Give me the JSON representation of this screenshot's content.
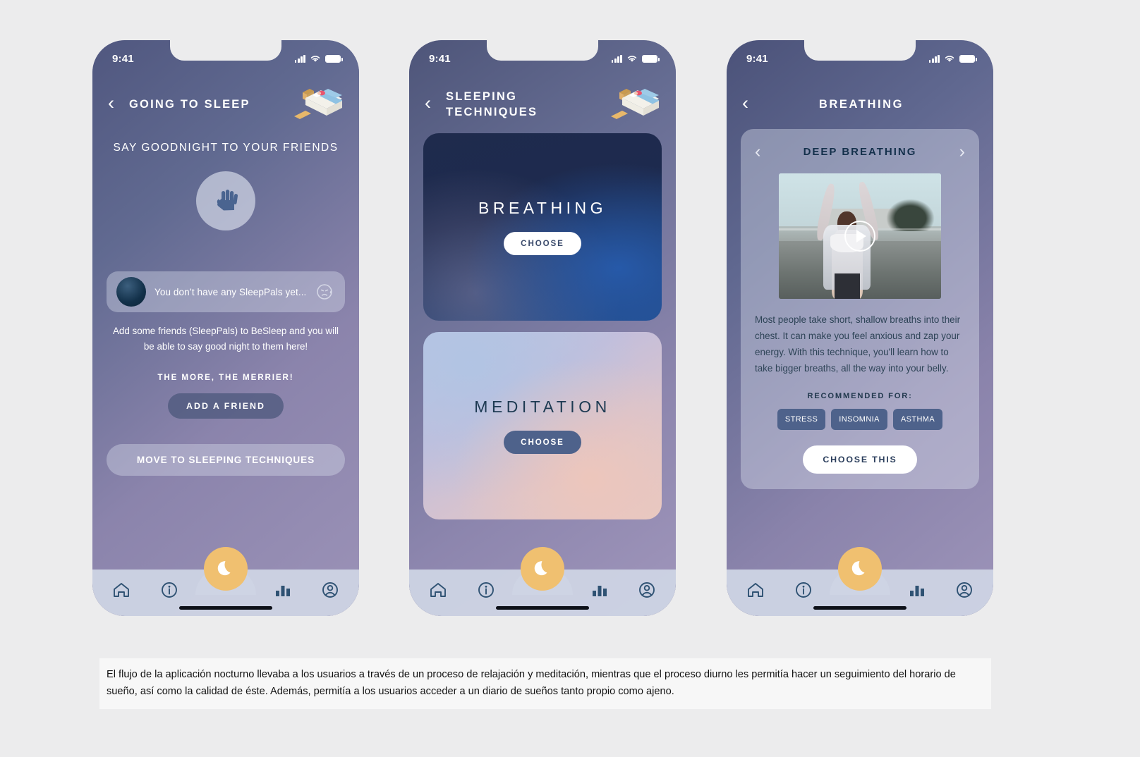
{
  "statusbar": {
    "time": "9:41"
  },
  "screen1": {
    "header_title": "GOING TO SLEEP",
    "back_label": "‹",
    "subtitle": "SAY GOODNIGHT TO YOUR FRIENDS",
    "hand_icon": "waving-hand-icon",
    "pal_card": {
      "text": "You don’t have any SleepPals yet...",
      "emoji_icon": "sad-face-with-tear-icon"
    },
    "body": "Add some friends (SleepPals) to BeSleep and you will be able to say good night to them here!",
    "merrier": "THE MORE, THE MERRIER!",
    "add_friend_label": "ADD A FRIEND",
    "move_label": "MOVE TO SLEEPING TECHNIQUES"
  },
  "screen2": {
    "header_title": "SLEEPING TECHNIQUES",
    "back_label": "‹",
    "cards": [
      {
        "title": "BREATHING",
        "button": "CHOOSE"
      },
      {
        "title": "MEDITATION",
        "button": "CHOOSE"
      }
    ]
  },
  "screen3": {
    "header_title": "BREATHING",
    "back_label": "‹",
    "detail": {
      "prev": "‹",
      "next": "›",
      "title": "DEEP BREATHING",
      "video_icon": "play-button-icon",
      "body": "Most people take short, shallow breaths into their chest. It can make you feel anxious and zap your energy. With this technique, you'll learn how to take bigger breaths, all the way into your belly.",
      "recommended_label": "RECOMMENDED FOR:",
      "tags": [
        "STRESS",
        "INSOMNIA",
        "ASTHMA"
      ],
      "choose_label": "CHOOSE THIS"
    }
  },
  "nav": {
    "items": [
      {
        "icon": "home-icon"
      },
      {
        "icon": "info-icon"
      },
      {
        "icon": "bar-chart-icon"
      },
      {
        "icon": "profile-icon"
      }
    ],
    "fab_icon": "moon-icon"
  },
  "caption": {
    "text": "El flujo de la aplicación nocturno llevaba a los usuarios a través de un proceso de relajación y meditación, mientras que el proceso diurno les permitía hacer un seguimiento del horario de sueño, así como la calidad de éste. Además, permitía a los usuarios acceder a un diario de sueños tanto propio como ajeno."
  },
  "colors": {
    "accent": "#f0c070",
    "slate": "#4e628b",
    "navy": "#14304b",
    "nav_bg": "#cdd4e4"
  }
}
